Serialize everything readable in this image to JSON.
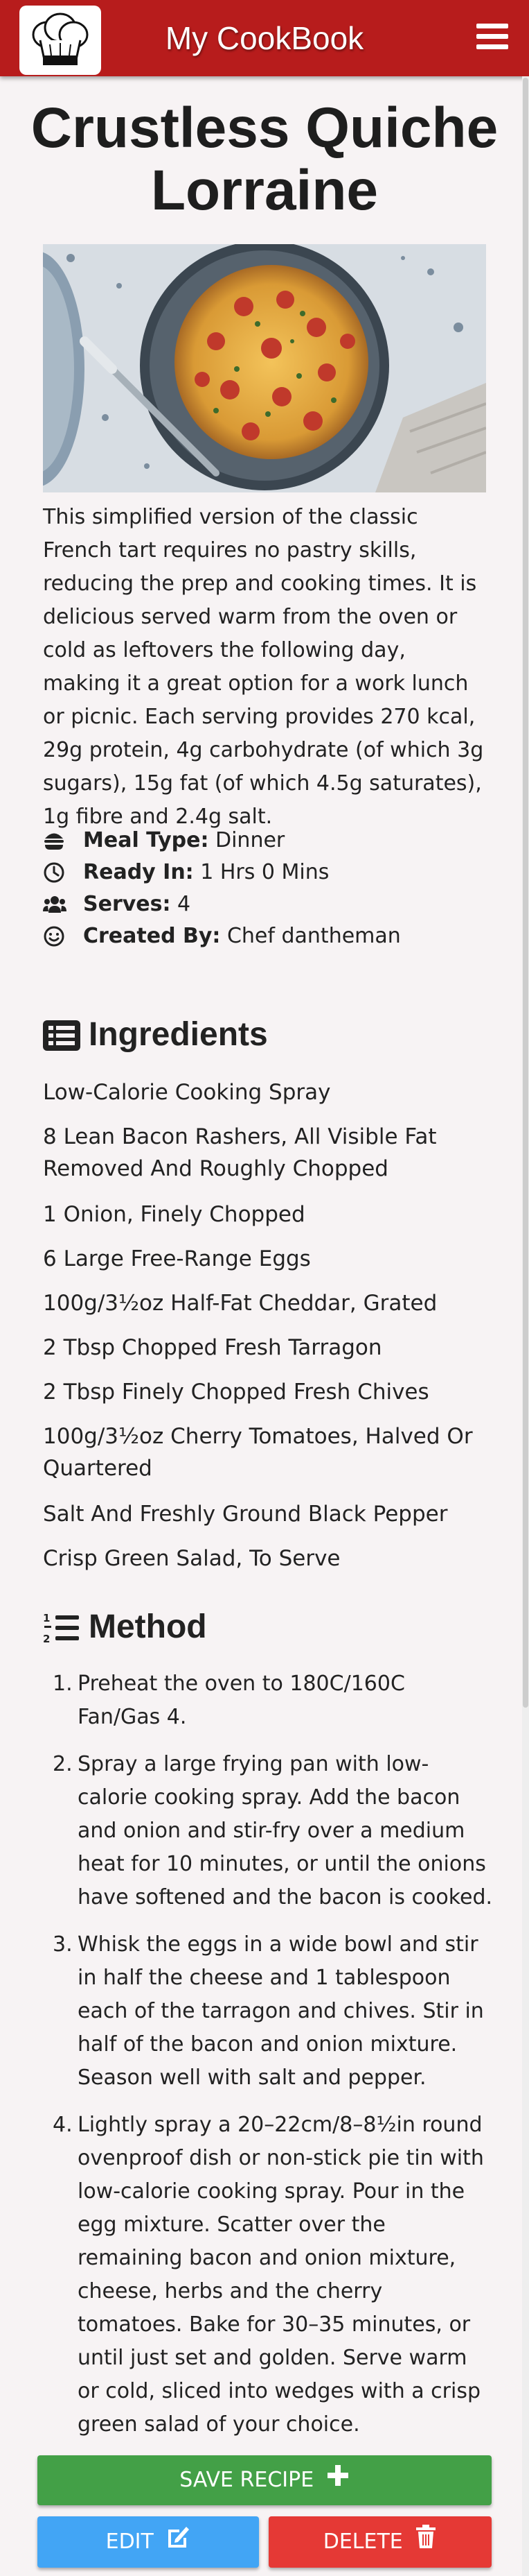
{
  "navbar": {
    "brand": "My CookBook",
    "logo_icon": "chef-hat-icon",
    "menu_icon": "hamburger-menu-icon"
  },
  "recipe": {
    "title": "Crustless Quiche Lorraine",
    "image_icon": "quiche-photo",
    "description": "This simplified version of the classic French tart requires no pastry skills, reducing the prep and cooking times. It is delicious served warm from the oven or cold as leftovers the following day, making it a great option for a work lunch or picnic. Each serving provides 270 kcal, 29g protein, 4g carbohydrate (of which 3g sugars), 15g fat (of which 4.5g saturates), 1g fibre and 2.4g salt.",
    "meta": [
      {
        "icon": "hamburger-food-icon",
        "label": "Meal Type:",
        "value": " Dinner"
      },
      {
        "icon": "clock-icon",
        "label": "Ready In:",
        "value": " 1 Hrs 0 Mins"
      },
      {
        "icon": "users-icon",
        "label": "Serves:",
        "value": " 4"
      },
      {
        "icon": "smile-icon",
        "label": "Created By:",
        "value": " Chef dantheman"
      }
    ]
  },
  "ingredients": {
    "heading": "Ingredients",
    "icon": "list-icon",
    "items": [
      "Low-Calorie Cooking Spray",
      "8 Lean Bacon Rashers, All Visible Fat Removed And Roughly Chopped",
      "1 Onion, Finely Chopped",
      "6 Large Free-Range Eggs",
      "100g/3½oz Half-Fat Cheddar, Grated",
      "2 Tbsp Chopped Fresh Tarragon",
      "2 Tbsp Finely Chopped Fresh Chives",
      "100g/3½oz Cherry Tomatoes, Halved Or Quartered",
      "Salt And Freshly Ground Black Pepper",
      "Crisp Green Salad, To Serve"
    ]
  },
  "method": {
    "heading": "Method",
    "icon": "ordered-list-icon",
    "steps": [
      {
        "num": "1.",
        "text": "Preheat the oven to 180C/160C Fan/Gas 4."
      },
      {
        "num": "2.",
        "text": "Spray a large frying pan with low-calorie cooking spray. Add the bacon and onion and stir-fry over a medium heat for 10 minutes, or until the onions have softened and the bacon is cooked."
      },
      {
        "num": "3.",
        "text": "Whisk the eggs in a wide bowl and stir in half the cheese and 1 tablespoon each of the tarragon and chives. Stir in half of the bacon and onion mixture. Season well with salt and pepper."
      },
      {
        "num": "4.",
        "text": "Lightly spray a 20–22cm/8–8½in round ovenproof dish or non-stick pie tin with low-calorie cooking spray. Pour in the egg mixture. Scatter over the remaining bacon and onion mixture, cheese, herbs and the cherry tomatoes. Bake for 30–35 minutes, or until just set and golden. Serve warm or cold, sliced into wedges with a crisp green salad of your choice."
      }
    ]
  },
  "actions": {
    "save_label": "SAVE RECIPE",
    "save_icon": "plus-icon",
    "edit_label": "EDIT",
    "edit_icon": "edit-icon",
    "delete_label": "DELETE",
    "delete_icon": "trash-icon"
  },
  "colors": {
    "navbar": "#b71c1c",
    "save": "#43a047",
    "edit": "#42a5f5",
    "delete": "#e53935",
    "background": "#f7f3f4"
  }
}
